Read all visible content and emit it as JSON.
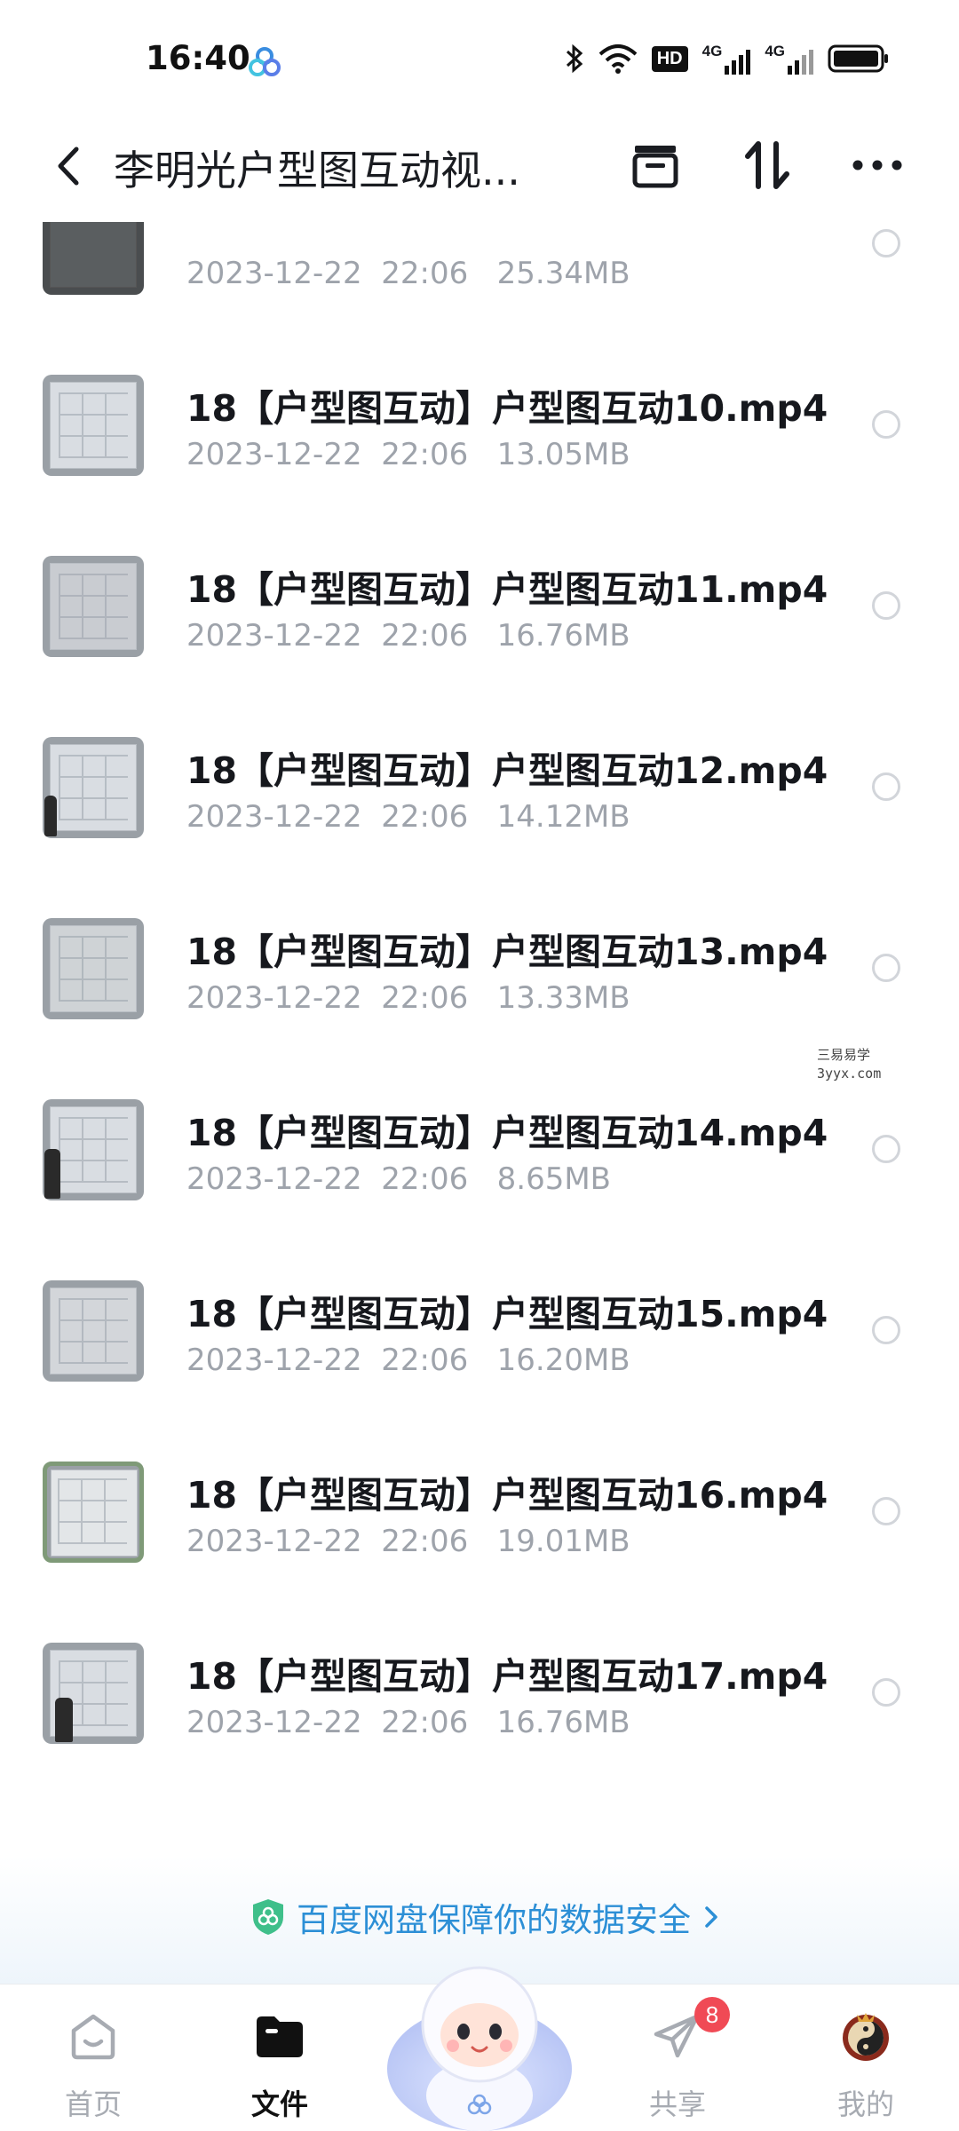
{
  "status_bar": {
    "time": "16:40",
    "hd_label": "HD",
    "net1": "4G",
    "net2": "4G"
  },
  "header": {
    "title": "李明光户型图互动视..."
  },
  "files": [
    {
      "name": "",
      "date": "2023-12-22",
      "time": "22:06",
      "size": "25.34MB"
    },
    {
      "name": "18【户型图互动】户型图互动10.mp4",
      "date": "2023-12-22",
      "time": "22:06",
      "size": "13.05MB"
    },
    {
      "name": "18【户型图互动】户型图互动11.mp4",
      "date": "2023-12-22",
      "time": "22:06",
      "size": "16.76MB"
    },
    {
      "name": "18【户型图互动】户型图互动12.mp4",
      "date": "2023-12-22",
      "time": "22:06",
      "size": "14.12MB"
    },
    {
      "name": "18【户型图互动】户型图互动13.mp4",
      "date": "2023-12-22",
      "time": "22:06",
      "size": "13.33MB"
    },
    {
      "name": "18【户型图互动】户型图互动14.mp4",
      "date": "2023-12-22",
      "time": "22:06",
      "size": "8.65MB"
    },
    {
      "name": "18【户型图互动】户型图互动15.mp4",
      "date": "2023-12-22",
      "time": "22:06",
      "size": "16.20MB"
    },
    {
      "name": "18【户型图互动】户型图互动16.mp4",
      "date": "2023-12-22",
      "time": "22:06",
      "size": "19.01MB"
    },
    {
      "name": "18【户型图互动】户型图互动17.mp4",
      "date": "2023-12-22",
      "time": "22:06",
      "size": "16.76MB"
    }
  ],
  "watermark": {
    "line1": "三易易学",
    "line2": "3yyx.com"
  },
  "safety_banner": {
    "text": "百度网盘保障你的数据安全"
  },
  "nav": {
    "home": "首页",
    "files": "文件",
    "share": "共享",
    "share_badge": "8",
    "me": "我的"
  },
  "colors": {
    "accent": "#2c8fd6",
    "badge": "#f04a55",
    "meta": "#9ea3ab"
  }
}
